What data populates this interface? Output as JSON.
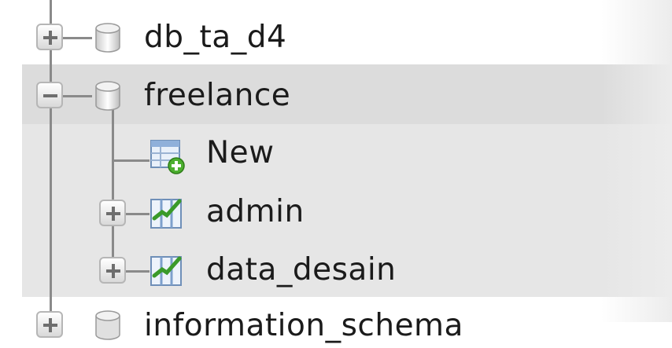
{
  "tree": {
    "items": [
      {
        "label": "db_ta_d4",
        "icon": "database-icon",
        "expander": "expand"
      },
      {
        "label": "freelance",
        "icon": "database-icon",
        "expander": "collapse",
        "children": [
          {
            "label": "New",
            "icon": "new-table-icon"
          },
          {
            "label": "admin",
            "icon": "table-icon",
            "expander": "expand"
          },
          {
            "label": "data_desain",
            "icon": "table-icon",
            "expander": "expand"
          }
        ]
      },
      {
        "label": "information_schema",
        "icon": "database-icon",
        "expander": "expand"
      }
    ]
  },
  "colors": {
    "selection": "#e6e6e6",
    "line": "#8a8a8a",
    "text": "#1b1b1b"
  }
}
